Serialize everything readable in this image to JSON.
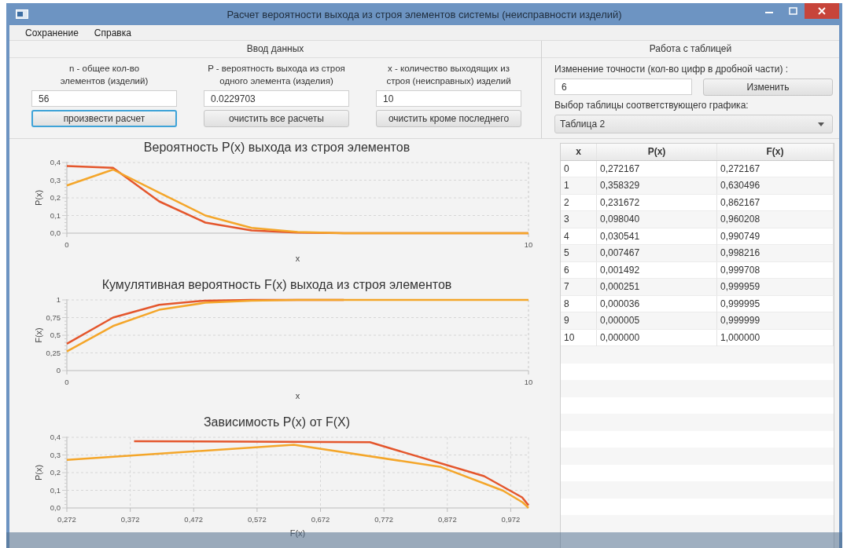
{
  "window": {
    "title": "Расчет вероятности выхода из строя элементов системы (неисправности изделий)"
  },
  "menu": [
    "Сохранение",
    "Справка"
  ],
  "input_panel": {
    "title": "Ввод данных",
    "fields": [
      {
        "label": "n - общее кол-во\nэлементов (изделий)",
        "value": "56"
      },
      {
        "label": "P - вероятность выхода из строя\nодного элемента (изделия)",
        "value": "0.0229703"
      },
      {
        "label": "x - количество выходящих из\nстроя (неисправных) изделий",
        "value": "10"
      }
    ],
    "buttons": [
      {
        "label": "произвести расчет",
        "focused": true
      },
      {
        "label": "очистить все расчеты",
        "focused": false
      },
      {
        "label": "очистить кроме последнего",
        "focused": false
      }
    ]
  },
  "table_panel": {
    "title": "Работа с таблицей",
    "precision_label": "Изменение точности (кол-во цифр в дробной части) :",
    "precision_value": "6",
    "apply_button": "Изменить",
    "select_label": "Выбор таблицы соответствующего графика:",
    "select_value": "Таблица 2"
  },
  "table": {
    "columns": [
      "x",
      "P(x)",
      "F(x)"
    ],
    "rows": [
      [
        "0",
        "0,272167",
        "0,272167"
      ],
      [
        "1",
        "0,358329",
        "0,630496"
      ],
      [
        "2",
        "0,231672",
        "0,862167"
      ],
      [
        "3",
        "0,098040",
        "0,960208"
      ],
      [
        "4",
        "0,030541",
        "0,990749"
      ],
      [
        "5",
        "0,007467",
        "0,998216"
      ],
      [
        "6",
        "0,001492",
        "0,999708"
      ],
      [
        "7",
        "0,000251",
        "0,999959"
      ],
      [
        "8",
        "0,000036",
        "0,999995"
      ],
      [
        "9",
        "0,000005",
        "0,999999"
      ],
      [
        "10",
        "0,000000",
        "1,000000"
      ]
    ]
  },
  "charts": [
    {
      "chart_data": {
        "type": "line",
        "title": "Вероятность P(x) выхода из строя элементов",
        "xlabel": "x",
        "ylabel": "P(x)",
        "x": [
          0,
          1,
          2,
          3,
          4,
          5,
          6,
          7,
          8,
          9,
          10
        ],
        "xlim": [
          0,
          10
        ],
        "ylim": [
          0,
          0.4
        ],
        "xticks": [
          {
            "value": 0,
            "label": "0"
          },
          {
            "value": 10,
            "label": "10"
          }
        ],
        "yticks": [
          {
            "value": 0,
            "label": "0,0"
          },
          {
            "value": 0.1,
            "label": "0,1"
          },
          {
            "value": 0.2,
            "label": "0,2"
          },
          {
            "value": 0.3,
            "label": "0,3"
          },
          {
            "value": 0.4,
            "label": "0,4"
          }
        ],
        "series": [
          {
            "color": "#e4562c",
            "values": [
              0.38,
              0.37,
              0.18,
              0.06,
              0.015,
              0.003,
              0,
              0,
              0,
              0,
              0
            ]
          },
          {
            "color": "#f4a62a",
            "values": [
              0.27,
              0.36,
              0.23,
              0.1,
              0.03,
              0.007,
              0,
              0,
              0,
              0,
              0
            ]
          }
        ],
        "grid": true
      }
    },
    {
      "chart_data": {
        "type": "line",
        "title": "Кумулятивная вероятность F(x) выхода из строя элементов",
        "xlabel": "x",
        "ylabel": "F(x)",
        "x": [
          0,
          1,
          2,
          3,
          4,
          5,
          6,
          7,
          8,
          9,
          10
        ],
        "xlim": [
          0,
          10
        ],
        "ylim": [
          0,
          1
        ],
        "xticks": [
          {
            "value": 0,
            "label": "0"
          },
          {
            "value": 10,
            "label": "10"
          }
        ],
        "yticks": [
          {
            "value": 0,
            "label": "0"
          },
          {
            "value": 0.25,
            "label": "0,25"
          },
          {
            "value": 0.5,
            "label": "0,5"
          },
          {
            "value": 0.75,
            "label": "0,75"
          },
          {
            "value": 1,
            "label": "1"
          }
        ],
        "series": [
          {
            "color": "#e4562c",
            "values": [
              0.38,
              0.75,
              0.93,
              0.99,
              1,
              1,
              1,
              null,
              null,
              null,
              null
            ]
          },
          {
            "color": "#f4a62a",
            "values": [
              0.27,
              0.63,
              0.86,
              0.96,
              0.99,
              1,
              1,
              1,
              1,
              1,
              1
            ]
          }
        ],
        "grid": true
      }
    },
    {
      "chart_data": {
        "type": "line",
        "title": "Зависимость P(x) от F(X)",
        "xlabel": "F(x)",
        "ylabel": "P(x)",
        "xlim": [
          0.272,
          1
        ],
        "ylim": [
          0,
          0.4
        ],
        "xticks": [
          {
            "value": 0.272,
            "label": "0,272"
          },
          {
            "value": 0.372,
            "label": "0,372"
          },
          {
            "value": 0.472,
            "label": "0,472"
          },
          {
            "value": 0.572,
            "label": "0,572"
          },
          {
            "value": 0.672,
            "label": "0,672"
          },
          {
            "value": 0.772,
            "label": "0,772"
          },
          {
            "value": 0.872,
            "label": "0,872"
          },
          {
            "value": 0.972,
            "label": "0,972"
          }
        ],
        "yticks": [
          {
            "value": 0,
            "label": "0,0"
          },
          {
            "value": 0.1,
            "label": "0,1"
          },
          {
            "value": 0.2,
            "label": "0,2"
          },
          {
            "value": 0.3,
            "label": "0,3"
          },
          {
            "value": 0.4,
            "label": "0,4"
          }
        ],
        "series": [
          {
            "color": "#e4562c",
            "x": [
              0.378,
              0.75,
              0.93,
              0.99,
              1
            ],
            "values": [
              0.378,
              0.372,
              0.18,
              0.06,
              0.015
            ]
          },
          {
            "color": "#f4a62a",
            "x": [
              0.272,
              0.63,
              0.862,
              0.96,
              0.991,
              0.998,
              1
            ],
            "values": [
              0.272,
              0.358,
              0.232,
              0.098,
              0.031,
              0.007,
              0
            ]
          }
        ],
        "grid": true
      }
    }
  ]
}
